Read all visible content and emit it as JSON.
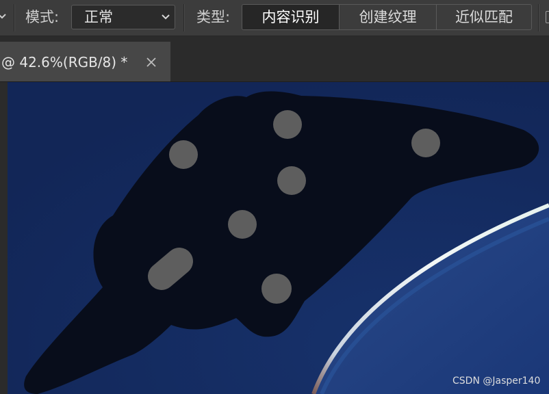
{
  "options_bar": {
    "mode_label": "模式:",
    "mode_value": "正常",
    "type_label": "类型:",
    "type_options": [
      {
        "label": "内容识别",
        "active": true
      },
      {
        "label": "创建纹理",
        "active": false
      },
      {
        "label": "近似匹配",
        "active": false
      }
    ]
  },
  "document_tab": {
    "title": "@ 42.6%(RGB/8) *",
    "close_icon": "close-icon"
  },
  "canvas": {
    "background_color": "#142a5c",
    "mask_color": "#080d1b",
    "spot_color": "#5e5e5e"
  },
  "watermark": "CSDN @Jasper140"
}
